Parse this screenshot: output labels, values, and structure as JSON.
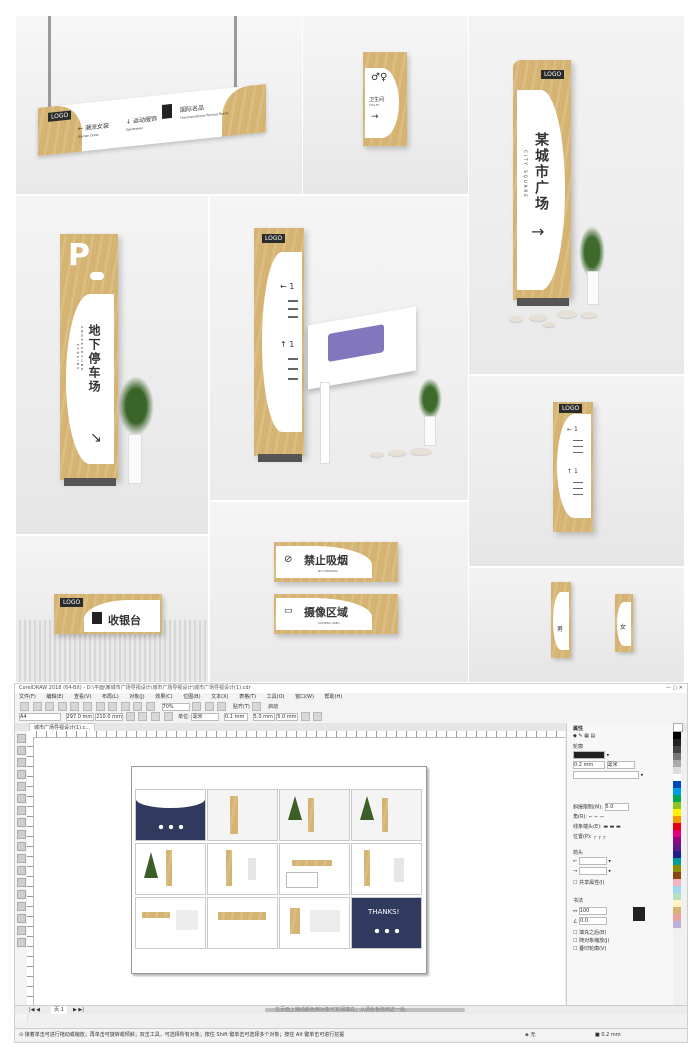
{
  "signs": {
    "hanging": {
      "logo": "LOGO",
      "items": [
        "潮流女装",
        "运动服饰",
        "国际名品"
      ],
      "subs": [
        "Women Dress",
        "Sportswear",
        "The International Famous Brand"
      ]
    },
    "toilet": {
      "label": "卫生间",
      "sub": "TOILET"
    },
    "city": {
      "logo": "LOGO",
      "title": "某城市广场",
      "sub": "CITY SQUARE"
    },
    "parking": {
      "letter": "P",
      "title": "地下停车场",
      "sub1": "UNDERGROUND",
      "sub2": "PARKING"
    },
    "directory": {
      "logo": "LOGO",
      "numbers": [
        "1",
        "1"
      ]
    },
    "wall": {
      "logo": "LOGO",
      "numbers": [
        "1",
        "1"
      ]
    },
    "cashier": {
      "logo": "LOGO",
      "label": "收银台"
    },
    "nosmoke": {
      "label": "禁止吸烟",
      "sub": "NO SMOKING"
    },
    "camera": {
      "label": "摄像区域",
      "sub": "CAMERA AREA"
    },
    "restroom_small": {
      "male": "男",
      "female": "女"
    }
  },
  "corel": {
    "title": "CorelDRAW 2018 (64-Bit) - D:\\平面\\某城市广场导视设计\\城市广场导视设计\\城市广场导视设计(1).cdr",
    "menu": [
      "文件(F)",
      "编辑(E)",
      "查看(V)",
      "布局(L)",
      "对象(J)",
      "效果(C)",
      "位图(B)",
      "文本(X)",
      "表格(T)",
      "工具(O)",
      "窗口(W)",
      "帮助(H)"
    ],
    "zoom": "70%",
    "snap": "贴齐(T)",
    "launch": "启动",
    "page_size": "A4",
    "width": "297.0 mm",
    "height": "210.0 mm",
    "units_label": "单位:",
    "units": "毫米",
    "nudge": "0.1 mm",
    "dup_x": "5.0 mm",
    "dup_y": "5.0 mm",
    "doc_tab": "城市广场导视设计(1).c...",
    "page_tab": "页 1",
    "status_left": "接着单击可进行拖动或缩放；再单击可旋转或倾斜；双击工具，可选择所有对象；按住 Shift 键单击可选择多个对象；按住 Alt 键单击可进行挖掘",
    "status_hint": "在页面上拖动颜色到对象可实现填充；从调色板拖到这一处。",
    "fill_status": "无",
    "thanks": "THANKS!",
    "props": {
      "header": "属性",
      "outline": "轮廓",
      "width_val": "0.2 mm",
      "width_unit": "毫米",
      "miter_label": "斜接限制(M):",
      "miter_val": "5.0",
      "corner_label": "角(R):",
      "cap_label": "线条端头(E):",
      "pos_label": "位置(P):",
      "arrow_label": "箭头",
      "share_label": "共享属性(I)",
      "fill_header": "书法",
      "stretch_val": "100",
      "angle_val": "0.0",
      "check1": "填充之后(B)",
      "check2": "随对象缩放(J)",
      "check3": "叠印轮廓(V)"
    }
  },
  "colors": {
    "navy": "#2f3a5e",
    "wood": "#d6b472"
  }
}
